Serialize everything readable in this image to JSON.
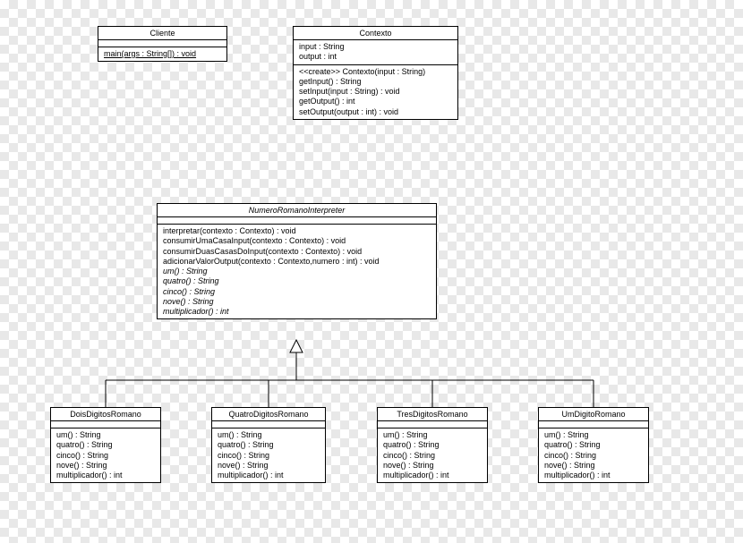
{
  "classes": {
    "cliente": {
      "name": "Cliente",
      "abstract": false,
      "attrs": [],
      "ops": [
        {
          "text": "main(args : String[]) : void",
          "static": true
        }
      ]
    },
    "contexto": {
      "name": "Contexto",
      "abstract": false,
      "attrs": [
        {
          "text": "input : String"
        },
        {
          "text": "output : int"
        }
      ],
      "ops": [
        {
          "text": "<<create>> Contexto(input : String)"
        },
        {
          "text": "getInput() : String"
        },
        {
          "text": "setInput(input : String) : void"
        },
        {
          "text": "getOutput() : int"
        },
        {
          "text": "setOutput(output : int) : void"
        }
      ]
    },
    "interpreter": {
      "name": "NumeroRomanoInterpreter",
      "abstract": true,
      "attrs": [],
      "ops": [
        {
          "text": "interpretar(contexto : Contexto) : void"
        },
        {
          "text": "consumirUmaCasaInput(contexto : Contexto) : void"
        },
        {
          "text": "consumirDuasCasasDoInput(contexto : Contexto) : void"
        },
        {
          "text": "adicionarValorOutput(contexto : Contexto,numero : int) : void"
        },
        {
          "text": "um() : String",
          "abstract": true
        },
        {
          "text": "quatro() : String",
          "abstract": true
        },
        {
          "text": "cinco() : String",
          "abstract": true
        },
        {
          "text": "nove() : String",
          "abstract": true
        },
        {
          "text": "multiplicador() : int",
          "abstract": true
        }
      ]
    },
    "dois": {
      "name": "DoisDigitosRomano",
      "abstract": false,
      "attrs": [],
      "ops": [
        {
          "text": "um() : String"
        },
        {
          "text": "quatro() : String"
        },
        {
          "text": "cinco() : String"
        },
        {
          "text": "nove() : String"
        },
        {
          "text": "multiplicador() : int"
        }
      ]
    },
    "quatro": {
      "name": "QuatroDigitosRomano",
      "abstract": false,
      "attrs": [],
      "ops": [
        {
          "text": "um() : String"
        },
        {
          "text": "quatro() : String"
        },
        {
          "text": "cinco() : String"
        },
        {
          "text": "nove() : String"
        },
        {
          "text": "multiplicador() : int"
        }
      ]
    },
    "tres": {
      "name": "TresDigitosRomano",
      "abstract": false,
      "attrs": [],
      "ops": [
        {
          "text": "um() : String"
        },
        {
          "text": "quatro() : String"
        },
        {
          "text": "cinco() : String"
        },
        {
          "text": "nove() : String"
        },
        {
          "text": "multiplicador() : int"
        }
      ]
    },
    "um": {
      "name": "UmDigitoRomano",
      "abstract": false,
      "attrs": [],
      "ops": [
        {
          "text": "um() : String"
        },
        {
          "text": "quatro() : String"
        },
        {
          "text": "cinco() : String"
        },
        {
          "text": "nove() : String"
        },
        {
          "text": "multiplicador() : int"
        }
      ]
    }
  }
}
